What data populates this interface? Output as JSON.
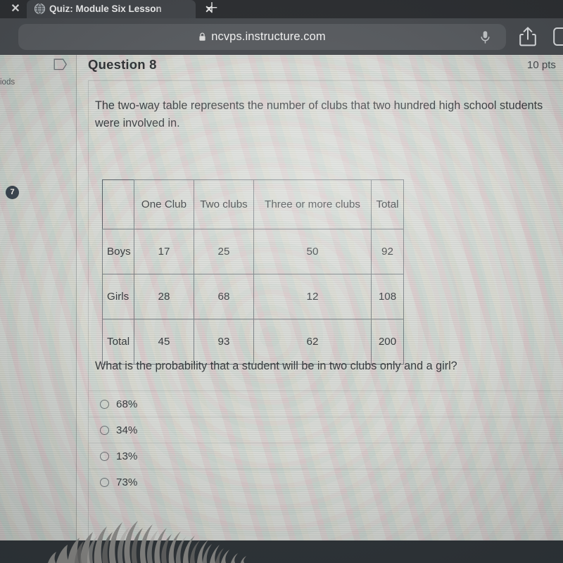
{
  "browser": {
    "left_close_icon": "✕",
    "tab": {
      "favicon": "globe-icon",
      "title": "Quiz: Module Six Lesson",
      "close_icon": "✕"
    },
    "new_tab_icon": "＋",
    "url": "ncvps.instructure.com",
    "lock_icon": "lock-icon",
    "mic_icon": "microphone-icon",
    "share_icon": "share-icon",
    "tabs_icon": "tabs-overview-icon"
  },
  "sidebar": {
    "truncated_label": "iods",
    "question_badge": "7"
  },
  "question": {
    "flag_icon": "bookmark-flag-icon",
    "title": "Question 8",
    "points": "10 pts",
    "prompt": "The two-way table represents the number of clubs that two hundred high school students were involved in.",
    "sub_question": "What is the probability that a student will be in two clubs only and a girl?"
  },
  "table": {
    "corner": "",
    "columns": [
      "One Club",
      "Two clubs",
      "Three or more clubs",
      "Total"
    ],
    "rows": [
      {
        "label": "Boys",
        "one": "17",
        "two": "25",
        "three": "50",
        "total": "92"
      },
      {
        "label": "Girls",
        "one": "28",
        "two": "68",
        "three": "12",
        "total": "108"
      },
      {
        "label": "Total",
        "one": "45",
        "two": "93",
        "three": "62",
        "total": "200"
      }
    ]
  },
  "answers": [
    {
      "label": "68%",
      "selected": false
    },
    {
      "label": "34%",
      "selected": false
    },
    {
      "label": "13%",
      "selected": false
    },
    {
      "label": "73%",
      "selected": false
    }
  ],
  "colors": {
    "chrome": "#4a4d51",
    "tabstrip": "#2e3033",
    "page_bg": "#d6d8d4",
    "badge": "#3d4753",
    "text": "#3b3f42"
  }
}
